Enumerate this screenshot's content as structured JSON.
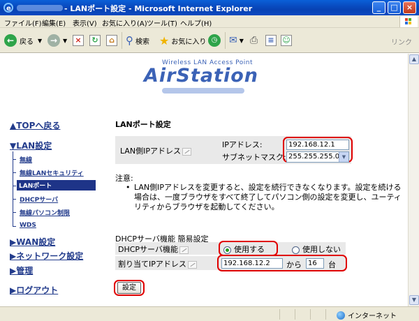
{
  "window": {
    "title": "- LANポート設定 - Microsoft Internet Explorer",
    "buttons": {
      "minimize": "_",
      "maximize": "□",
      "close": "×"
    }
  },
  "menu": [
    "ファイル(F)",
    "編集(E)",
    "表示(V)",
    "お気に入り(A)",
    "ツール(T)",
    "ヘルプ(H)"
  ],
  "toolbar": {
    "back": "戻る",
    "search": "検索",
    "favorites": "お気に入り",
    "links": "リンク"
  },
  "logo": {
    "sub": "Wireless LAN Access Point",
    "main": "AirStation"
  },
  "nav": {
    "top": "▲TOPへ戻る",
    "lan_settings": "▼LAN設定",
    "lan_items": [
      "無線",
      "無線LANセキュリティ",
      "LANポート",
      "DHCPサーバ",
      "無線パソコン制限",
      "WDS"
    ],
    "active_index": 2,
    "wan": "▶WAN設定",
    "network": "▶ネットワーク設定",
    "admin": "▶管理",
    "logout": "▶ログアウト"
  },
  "main": {
    "title": "LANポート設定",
    "lan_ip_label": "LAN側IPアドレス",
    "ip_label": "IPアドレス:",
    "subnet_label": "サブネットマスク:",
    "ip_value": "192.168.12.1",
    "subnet_value": "255.255.255.0",
    "note_title": "注意:",
    "note_text": "LAN側IPアドレスを変更すると、設定を続行できなくなります。設定を続ける場合は、一度ブラウザをすべて終了してパソコン側の設定を変更し、ユーティリティからブラウザを起動してください。",
    "dhcp_title": "DHCPサーバ機能 簡易設定",
    "dhcp_label": "DHCPサーバ機能",
    "dhcp_on": "使用する",
    "dhcp_off": "使用しない",
    "assign_label": "割り当てIPアドレス",
    "assign_start": "192.168.12.2",
    "from_label": "から",
    "count_value": "16",
    "count_unit": "台",
    "submit": "設定"
  },
  "status": {
    "zone": "インターネット"
  }
}
